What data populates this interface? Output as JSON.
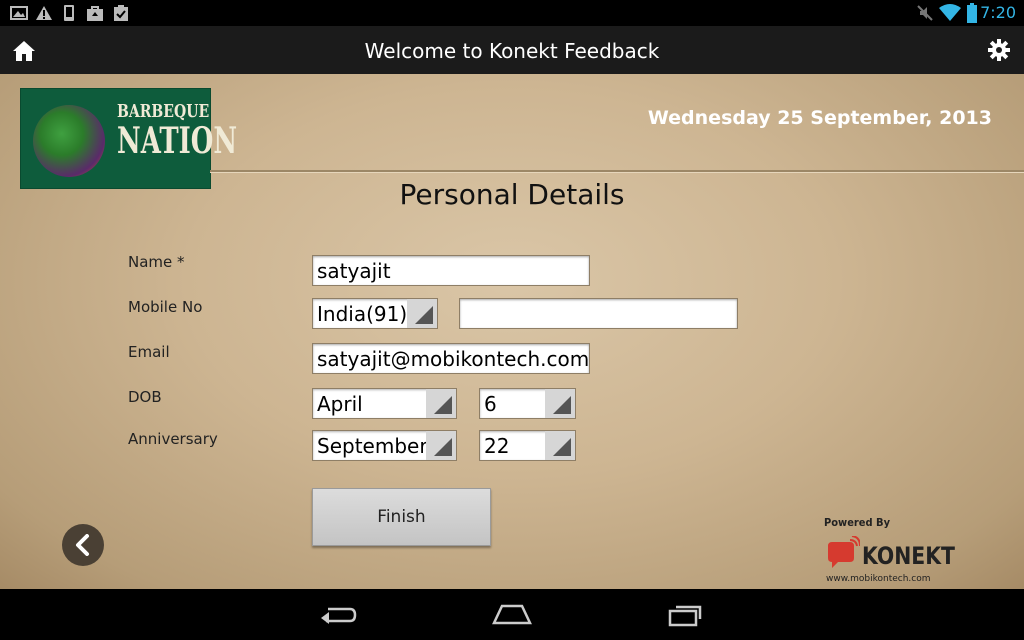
{
  "status_bar": {
    "time": "7:20",
    "left_icons": [
      "image-icon",
      "warning-icon",
      "phone-icon",
      "bag-icon",
      "clipboard-check-icon"
    ],
    "right_icons": [
      "mute-icon",
      "wifi-icon",
      "battery-icon"
    ],
    "accent_color": "#33b5e5"
  },
  "action_bar": {
    "title": "Welcome to Konekt Feedback"
  },
  "header": {
    "logo_line1": "BARBEQUE",
    "logo_line2": "NATION",
    "date": "Wednesday 25 September, 2013"
  },
  "form": {
    "heading": "Personal Details",
    "name_label": "Name *",
    "name_value": "satyajit",
    "mobile_label": "Mobile No",
    "country_code": "India(91)",
    "mobile_value": "",
    "email_label": "Email",
    "email_value": "satyajit@mobikontech.com",
    "dob_label": "DOB",
    "dob_month": "April",
    "dob_day": "6",
    "anniversary_label": "Anniversary",
    "anniv_month": "September",
    "anniv_day": "22",
    "finish_label": "Finish"
  },
  "branding": {
    "powered_by": "Powered By",
    "brand": "KONEKT",
    "url": "www.mobikontech.com"
  }
}
